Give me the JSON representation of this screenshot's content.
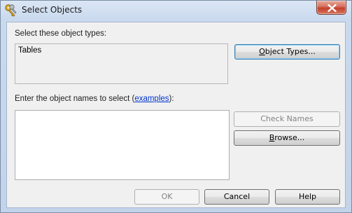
{
  "window": {
    "title": "Select Objects",
    "icon": "keys-icon",
    "close_icon": "close-icon"
  },
  "object_types": {
    "label": "Select these object types:",
    "value": "Tables",
    "button": {
      "pre": "",
      "mnemonic": "O",
      "post": "bject Types..."
    }
  },
  "object_names": {
    "label_pre": "Enter the object names to select (",
    "link_text": "examples",
    "label_post": "):",
    "value": ""
  },
  "buttons": {
    "check_names": "Check Names",
    "browse": {
      "pre": "",
      "mnemonic": "B",
      "post": "rowse..."
    },
    "ok": "OK",
    "cancel": "Cancel",
    "help": "Help"
  },
  "colors": {
    "close_button": "#c4402b",
    "link": "#0033cc",
    "focus_border": "#3c7fb1"
  }
}
